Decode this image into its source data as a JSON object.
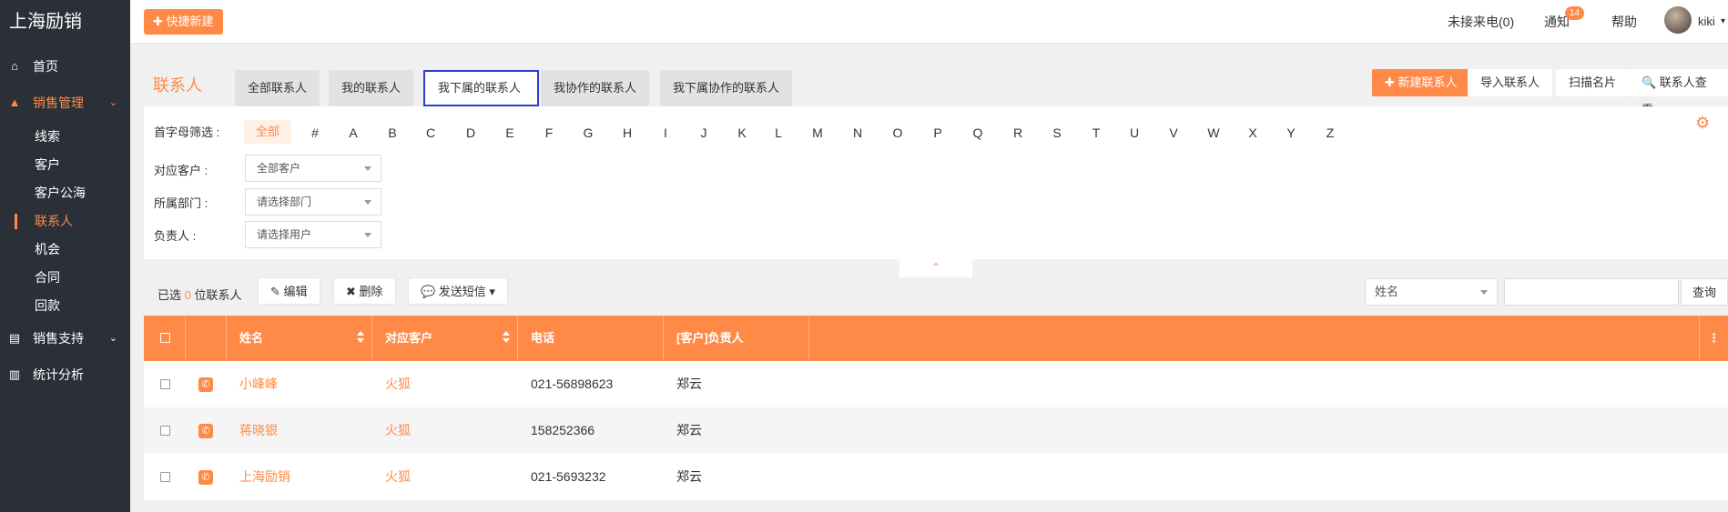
{
  "app": {
    "logo": "上海励销"
  },
  "sidebar": {
    "items": [
      {
        "label": "首页",
        "icon": "home-icon",
        "glyph": "⌂"
      },
      {
        "label": "销售管理",
        "icon": "area-chart-icon",
        "glyph": "▲",
        "chevron": "⌄"
      },
      {
        "label": "销售支持",
        "icon": "document-icon",
        "glyph": "▤",
        "chevron": "⌄"
      },
      {
        "label": "统计分析",
        "icon": "bar-chart-icon",
        "glyph": "▥"
      }
    ],
    "sub_items": [
      "线索",
      "客户",
      "客户公海",
      "联系人",
      "机会",
      "合同",
      "回款"
    ],
    "current_sub": "联系人"
  },
  "topbar": {
    "quick_create": "✚ 快捷新建",
    "missed_calls": "未接来电(0)",
    "notify": "通知",
    "notify_count": "14",
    "help": "帮助",
    "user": "kiki",
    "user_caret": "▾"
  },
  "page": {
    "title": "联系人",
    "tabs": [
      "全部联系人",
      "我的联系人",
      "我下属的联系人",
      "我协作的联系人",
      "我下属协作的联系人"
    ],
    "selected_tab": "我下属的联系人",
    "actions": {
      "new_contact": "✚ 新建联系人",
      "import": "导入联系人",
      "scan_card": "扫描名片",
      "lookup": "🔍 联系人查重"
    }
  },
  "filters": {
    "initial_label": "首字母筛选 :",
    "letters": [
      "全部",
      "#",
      "A",
      "B",
      "C",
      "D",
      "E",
      "F",
      "G",
      "H",
      "I",
      "J",
      "K",
      "L",
      "M",
      "N",
      "O",
      "P",
      "Q",
      "R",
      "S",
      "T",
      "U",
      "V",
      "W",
      "X",
      "Y",
      "Z"
    ],
    "customer_label": "对应客户 :",
    "customer_value": "全部客户",
    "dept_label": "所属部门 :",
    "dept_placeholder": "请选择部门",
    "owner_label": "负责人 :",
    "owner_placeholder": "请选择用户",
    "collapse_glyph": "⌃"
  },
  "toolbar": {
    "selected_prefix": "已选 ",
    "selected_count": "0",
    "selected_suffix": " 位联系人",
    "edit": "✎ 编辑",
    "delete": "✖ 删除",
    "sms": "💬 发送短信 ▾",
    "search_field": "姓名",
    "search_btn": "查询"
  },
  "table": {
    "columns": [
      "姓名",
      "对应客户",
      "电话",
      "[客户]负责人"
    ],
    "more_glyph": "⋮",
    "rows": [
      {
        "name": "小峰峰",
        "customer": "火狐",
        "phone": "021-56898623",
        "owner": "郑云"
      },
      {
        "name": "蒋晓银",
        "customer": "火狐",
        "phone": "158252366",
        "owner": "郑云"
      },
      {
        "name": "上海励销",
        "customer": "火狐",
        "phone": "021-5693232",
        "owner": "郑云"
      }
    ]
  },
  "colors": {
    "accent": "#ff8a48",
    "sidebar_bg": "#2b3038",
    "tab_highlight": "#2b3ecf"
  }
}
